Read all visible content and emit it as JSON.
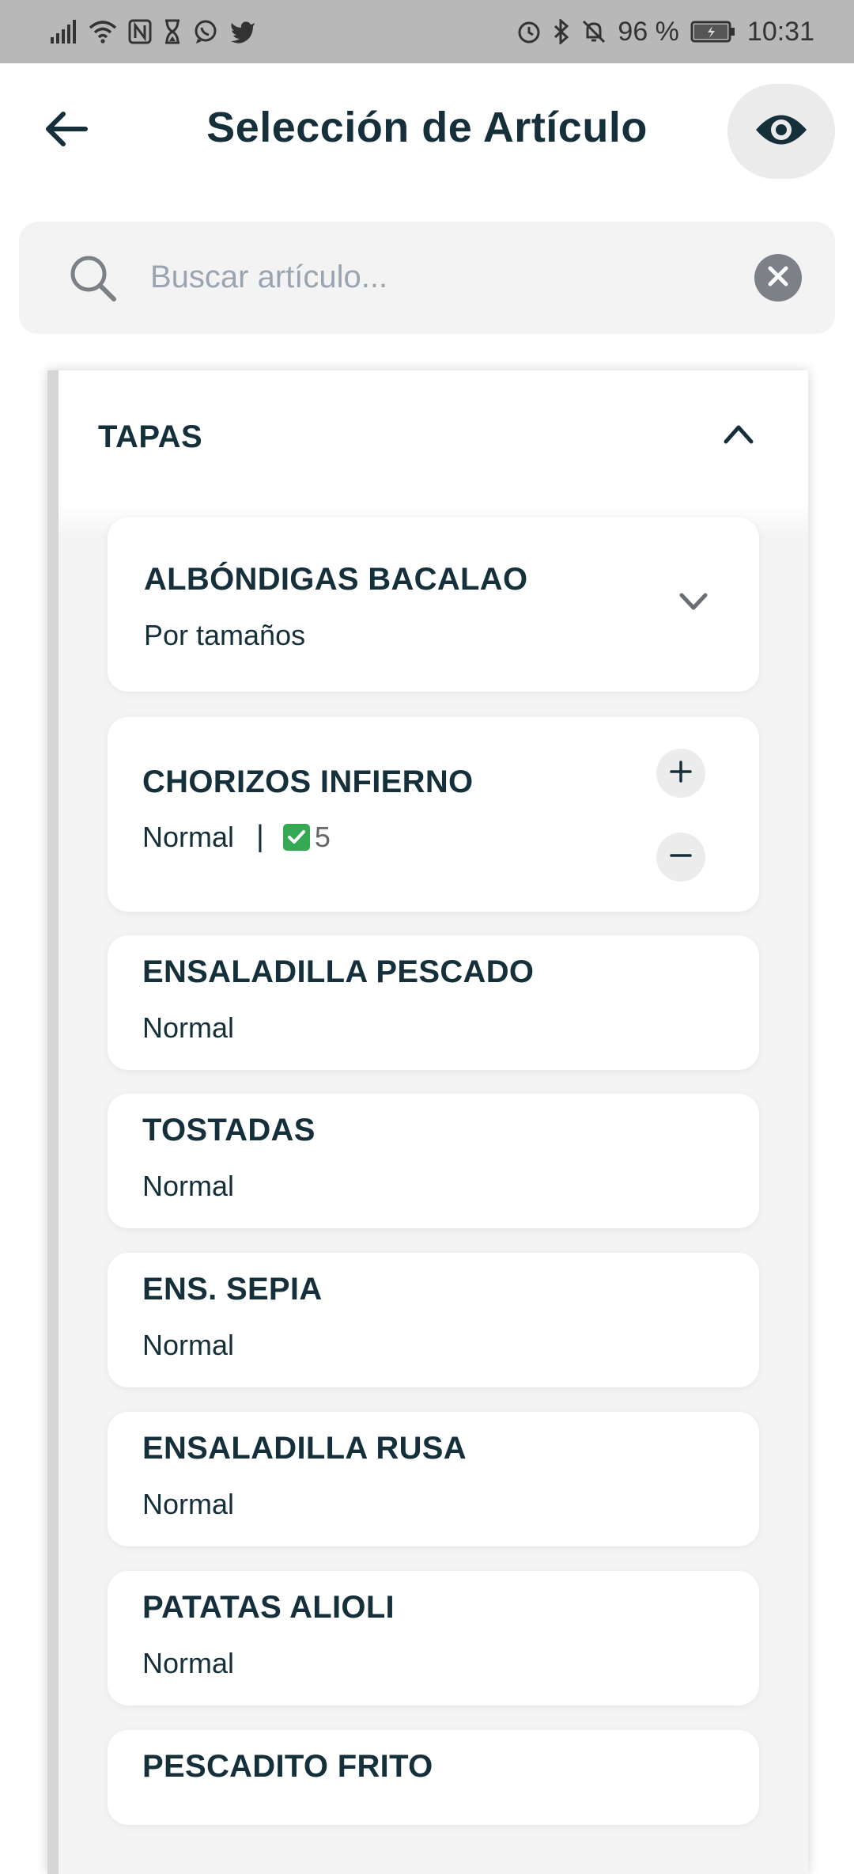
{
  "status_bar": {
    "battery": "96 %",
    "time": "10:31",
    "left_icons": [
      "signal-icon",
      "wifi-icon",
      "nfc-icon",
      "hourglass-icon",
      "whatsapp-icon",
      "twitter-icon"
    ],
    "right_icons": [
      "alarm-icon",
      "bluetooth-icon",
      "bell-off-icon",
      "battery-icon"
    ]
  },
  "header": {
    "title": "Selección de Artículo",
    "back_icon": "arrow-left-icon",
    "view_icon": "eye-icon"
  },
  "search": {
    "placeholder": "Buscar artículo...",
    "value": ""
  },
  "category": {
    "title": "TAPAS",
    "expanded": true,
    "items": [
      {
        "name": "ALBÓNDIGAS BACALAO",
        "subtitle": "Por tamaños",
        "expandable": true
      },
      {
        "name": "CHORIZOS INFIERNO",
        "subtitle": "Normal",
        "pipe": "|",
        "quantity": "5",
        "selected": true,
        "plus": "+",
        "minus": "−"
      },
      {
        "name": "ENSALADILLA PESCADO",
        "subtitle": "Normal"
      },
      {
        "name": "TOSTADAS",
        "subtitle": "Normal"
      },
      {
        "name": "ENS. SEPIA",
        "subtitle": "Normal"
      },
      {
        "name": "ENSALADILLA RUSA",
        "subtitle": "Normal"
      },
      {
        "name": "PATATAS ALIOLI",
        "subtitle": "Normal"
      },
      {
        "name": "PESCADITO FRITO",
        "subtitle": ""
      }
    ]
  },
  "colors": {
    "text_primary": "#15303a",
    "check_green": "#34a853",
    "status_bar_bg": "#b8b8b8",
    "search_bg": "#f3f3f3",
    "placeholder": "#9aa5b1"
  }
}
